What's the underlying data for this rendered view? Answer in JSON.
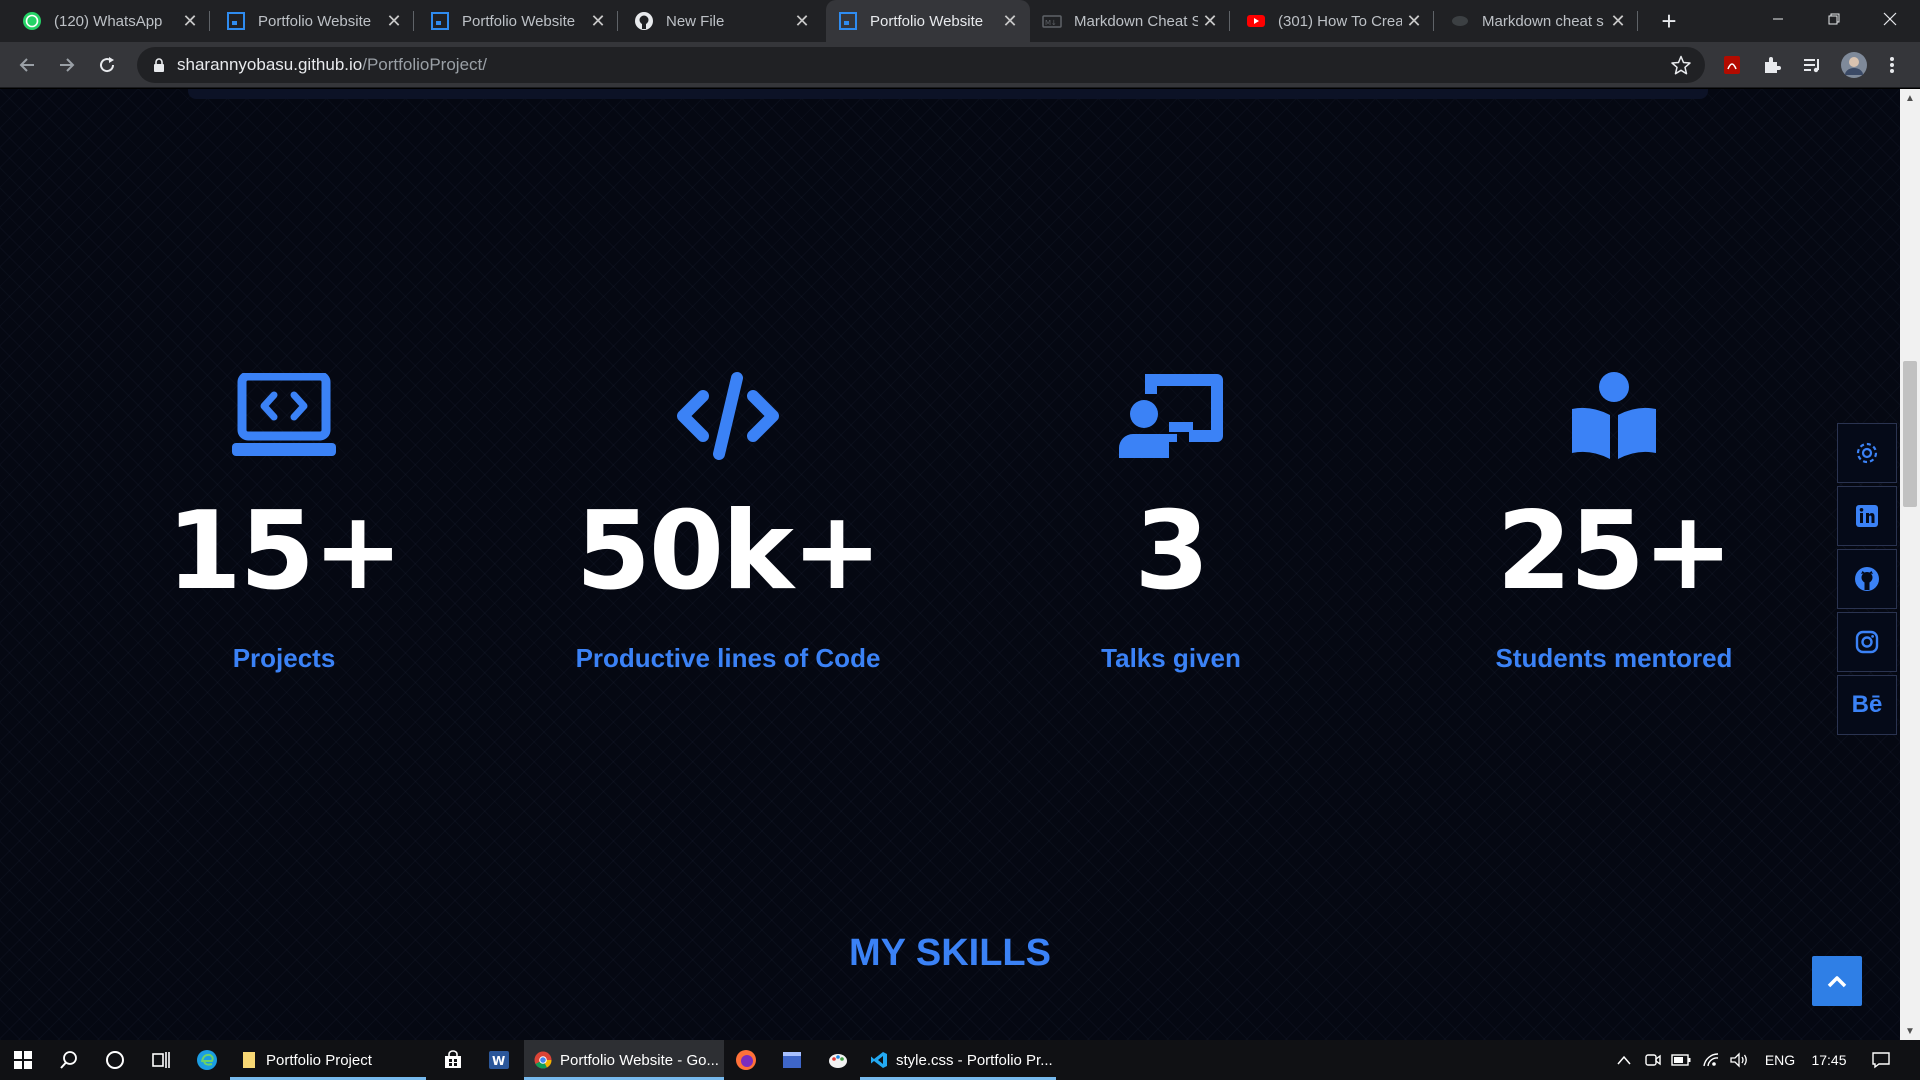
{
  "browser": {
    "tabs": [
      {
        "title": "(120) WhatsApp",
        "icon": "whatsapp-icon"
      },
      {
        "title": "Portfolio Website",
        "icon": "portfolio-favicon"
      },
      {
        "title": "Portfolio Website",
        "icon": "portfolio-favicon"
      },
      {
        "title": "New File",
        "icon": "github-icon"
      },
      {
        "title": "Portfolio Website",
        "icon": "portfolio-favicon",
        "active": true
      },
      {
        "title": "Markdown Cheat S",
        "icon": "markdown-icon"
      },
      {
        "title": "(301) How To Crea",
        "icon": "youtube-icon"
      },
      {
        "title": "Markdown cheat s",
        "icon": "page-icon"
      }
    ],
    "url_host": "sharannyobasu.github.io",
    "url_path": "/PortfolioProject/"
  },
  "page": {
    "stats": [
      {
        "value": "15+",
        "label": "Projects",
        "icon": "laptop-code-icon"
      },
      {
        "value": "50k+",
        "label": "Productive lines of Code",
        "icon": "code-icon"
      },
      {
        "value": "3",
        "label": "Talks given",
        "icon": "chalkboard-teacher-icon"
      },
      {
        "value": "25+",
        "label": "Students mentored",
        "icon": "book-reader-icon"
      }
    ],
    "skills_title": "MY SKILLS",
    "social": {
      "behance_label": "Bē"
    },
    "accent_color": "#3b82f6"
  },
  "taskbar": {
    "apps": [
      {
        "label": "Portfolio Project",
        "icon": "folder-icon"
      },
      {
        "label": "Portfolio Website - Go...",
        "icon": "chrome-icon"
      },
      {
        "label": "style.css - Portfolio Pr...",
        "icon": "vscode-icon"
      }
    ],
    "language": "ENG",
    "time": "17:45"
  }
}
